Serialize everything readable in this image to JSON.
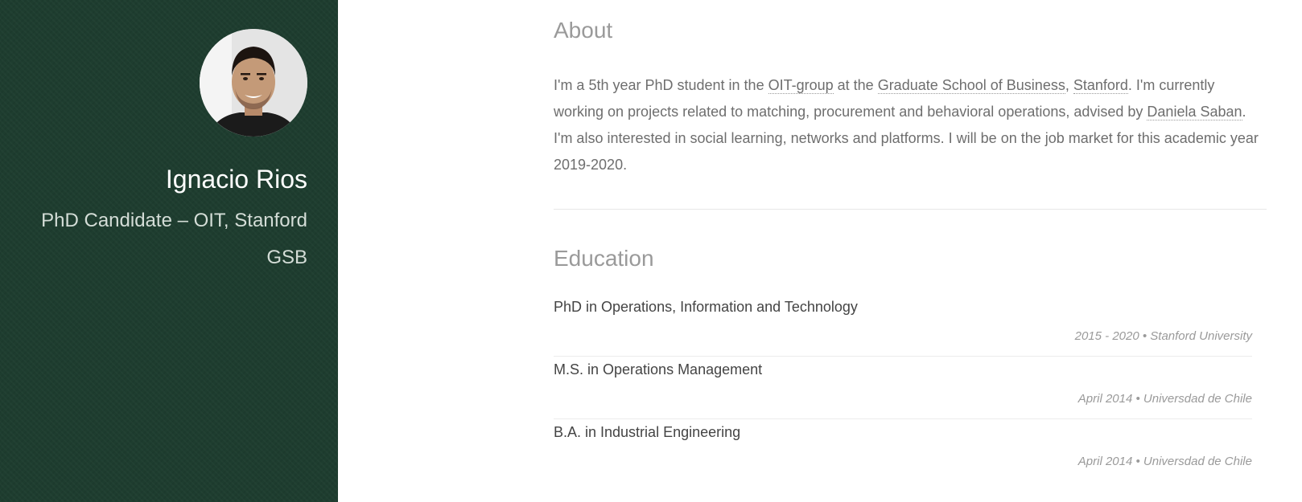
{
  "sidebar": {
    "name": "Ignacio Rios",
    "role": "PhD Candidate – OIT, Stanford GSB",
    "background_color": "#1e3d2f"
  },
  "about": {
    "title": "About",
    "segments": [
      {
        "text": "I'm a 5th year PhD student in the ",
        "link": false
      },
      {
        "text": "OIT-group",
        "link": true
      },
      {
        "text": " at the ",
        "link": false
      },
      {
        "text": "Graduate School of Business",
        "link": true
      },
      {
        "text": ", ",
        "link": false
      },
      {
        "text": "Stanford",
        "link": true
      },
      {
        "text": ". I'm currently working on projects related to matching, procurement and behavioral operations, advised by ",
        "link": false
      },
      {
        "text": "Daniela Saban",
        "link": true
      },
      {
        "text": ". I'm also interested in social learning, networks and platforms. I will be on the job market for this academic year 2019-2020.",
        "link": false
      }
    ]
  },
  "education": {
    "title": "Education",
    "items": [
      {
        "degree": "PhD in Operations, Information and Technology",
        "meta": "2015 - 2020 • Stanford University"
      },
      {
        "degree": "M.S. in Operations Management",
        "meta": "April 2014 • Universdad de Chile"
      },
      {
        "degree": "B.A. in Industrial Engineering",
        "meta": "April 2014 • Universdad de Chile"
      }
    ]
  }
}
